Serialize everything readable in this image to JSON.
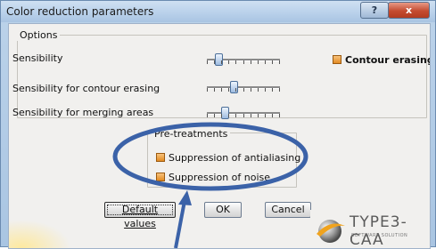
{
  "window": {
    "title": "Color reduction parameters",
    "help_label": "?",
    "close_label": "x"
  },
  "options": {
    "legend": "Options",
    "sensibility_label": "Sensibility",
    "contour_sensibility_label": "Sensibility for contour erasing",
    "merging_sensibility_label": "Sensibility for merging areas",
    "sensibility_value": 0.12,
    "contour_sensibility_value": 0.35,
    "merging_sensibility_value": 0.22,
    "contour_erasing_label": "Contour erasing",
    "contour_erasing_checked": true
  },
  "pretreatments": {
    "legend": "Pre-treatments",
    "antialiasing_label": "Suppression of antialiasing",
    "antialiasing_checked": true,
    "noise_label": "Suppression of noise",
    "noise_checked": true
  },
  "buttons": {
    "default_label": "Default values",
    "ok_label": "OK",
    "cancel_label": "Cancel"
  },
  "logo": {
    "name": "TYPE3-CAA",
    "tagline": "SOFTWARE SOLUTION"
  },
  "annotation": {
    "color": "#3b62a8"
  }
}
